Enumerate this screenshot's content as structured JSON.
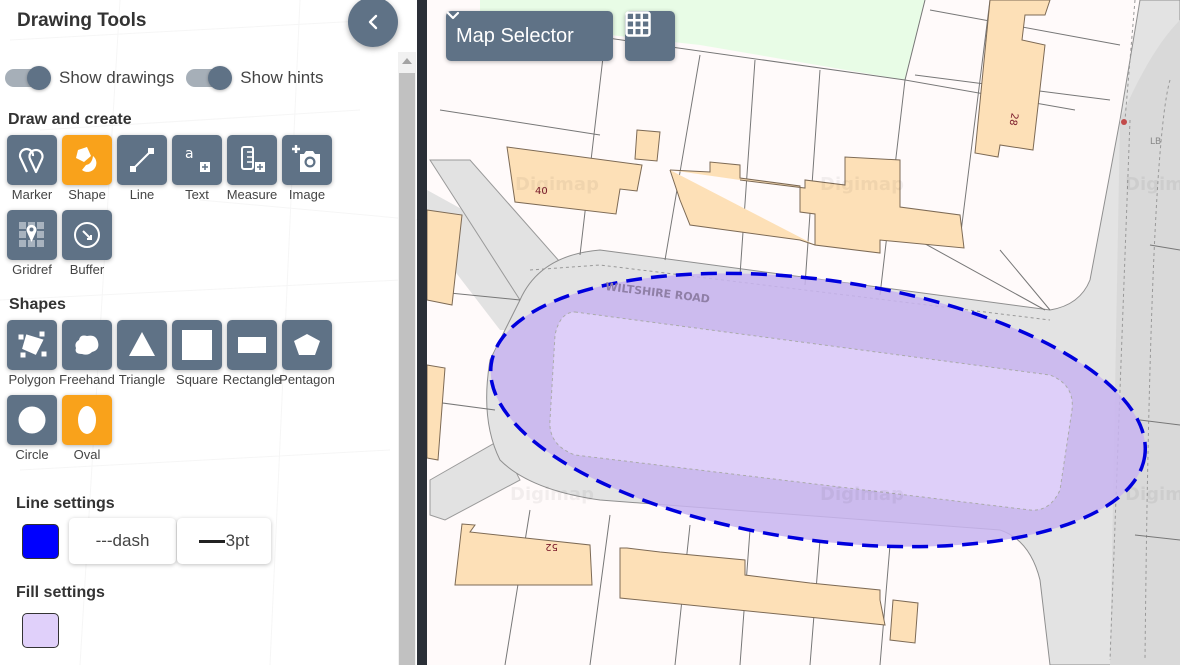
{
  "panel": {
    "title": "Drawing Tools",
    "collapse_icon": "chevron-left-icon",
    "toggles": [
      {
        "label": "Show drawings",
        "on": true
      },
      {
        "label": "Show hints",
        "on": true
      }
    ]
  },
  "draw_and_create": {
    "title": "Draw and create",
    "tools": [
      {
        "label": "Marker",
        "icon": "marker-icon",
        "active": false
      },
      {
        "label": "Shape",
        "icon": "shape-icon",
        "active": true
      },
      {
        "label": "Line",
        "icon": "line-icon",
        "active": false
      },
      {
        "label": "Text",
        "icon": "text-add-icon",
        "active": false
      },
      {
        "label": "Measure",
        "icon": "measure-icon",
        "active": false
      },
      {
        "label": "Image",
        "icon": "add-image-icon",
        "active": false
      },
      {
        "label": "Gridref",
        "icon": "gridref-icon",
        "active": false
      },
      {
        "label": "Buffer",
        "icon": "buffer-icon",
        "active": false
      }
    ]
  },
  "shapes": {
    "title": "Shapes",
    "tools": [
      {
        "label": "Polygon",
        "icon": "polygon-icon",
        "active": false
      },
      {
        "label": "Freehand",
        "icon": "freehand-icon",
        "active": false
      },
      {
        "label": "Triangle",
        "icon": "triangle-icon",
        "active": false
      },
      {
        "label": "Square",
        "icon": "square-icon",
        "active": false
      },
      {
        "label": "Rectangle",
        "icon": "rectangle-icon",
        "active": false
      },
      {
        "label": "Pentagon",
        "icon": "pentagon-icon",
        "active": false
      },
      {
        "label": "Circle",
        "icon": "circle-icon",
        "active": false
      },
      {
        "label": "Oval",
        "icon": "oval-icon",
        "active": true
      }
    ]
  },
  "line_settings": {
    "title": "Line settings",
    "color": "#0000ff",
    "style_label": "---dash",
    "width_label": "3pt"
  },
  "fill_settings": {
    "title": "Fill settings",
    "color": "#e0d0fa"
  },
  "map": {
    "selector_label": "Map Selector",
    "grid_icon": "grid-icon",
    "road_label": "WILTSHIRE ROAD",
    "house_numbers": [
      "40",
      "28",
      "52"
    ],
    "road_marking": "LB",
    "watermark": "Digimap",
    "drawn_shape": {
      "type": "oval",
      "stroke_color": "#0000dd",
      "stroke_style": "dash",
      "stroke_width_pt": 3,
      "fill_color": "#c8b4f0"
    }
  },
  "colors": {
    "tool_bg": "#5f7286",
    "tool_active": "#f9a21b",
    "building": "#fde0b7",
    "road": "#e2e2e2",
    "green": "#e8fce6"
  }
}
